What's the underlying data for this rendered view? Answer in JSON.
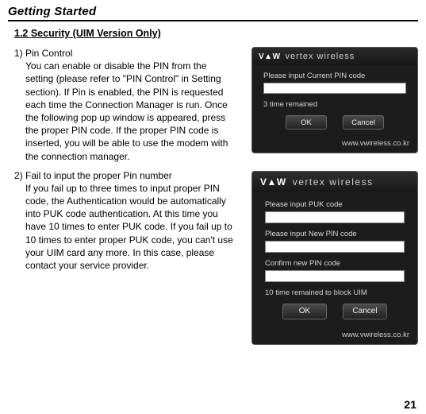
{
  "chapter": "Getting Started",
  "section": "1.2 Security (UIM Version Only)",
  "item1": {
    "lead": "1) Pin Control",
    "body": "You can enable or disable the PIN from the setting (please refer to \"PIN Control\" in Setting section). If Pin is enabled, the PIN is requested each time the Connection Manager is run. Once the following pop up window is appeared, press the proper PIN code. If the proper PIN code is inserted, you will be able to use the modem with the connection manager."
  },
  "item2": {
    "lead": "2) Fail to input the proper Pin number",
    "body": "If you fail up to three times to input proper PIN code, the Authentication would be automatically into PUK code authentication. At this time you have 10 times to enter PUK code. If you fail up to 10 times to enter proper PUK code, you can't use your UIM card any more. In this case, please contact your service provider."
  },
  "dialog1": {
    "logo": "V▲W",
    "brand": "vertex wireless",
    "label_pin": "Please input Current PIN code",
    "remain": "3 time remained",
    "ok": "OK",
    "cancel": "Cancel",
    "url": "www.vwireless.co.kr"
  },
  "dialog2": {
    "logo": "V▲W",
    "brand": "vertex wireless",
    "label_puk": "Please input PUK code",
    "label_newpin": "Please input New PIN code",
    "label_confirm": "Confirm new PIN code",
    "remain": "10 time remained to block UIM",
    "ok": "OK",
    "cancel": "Cancel",
    "url": "www.vwireless.co.kr"
  },
  "pagenum": "21"
}
